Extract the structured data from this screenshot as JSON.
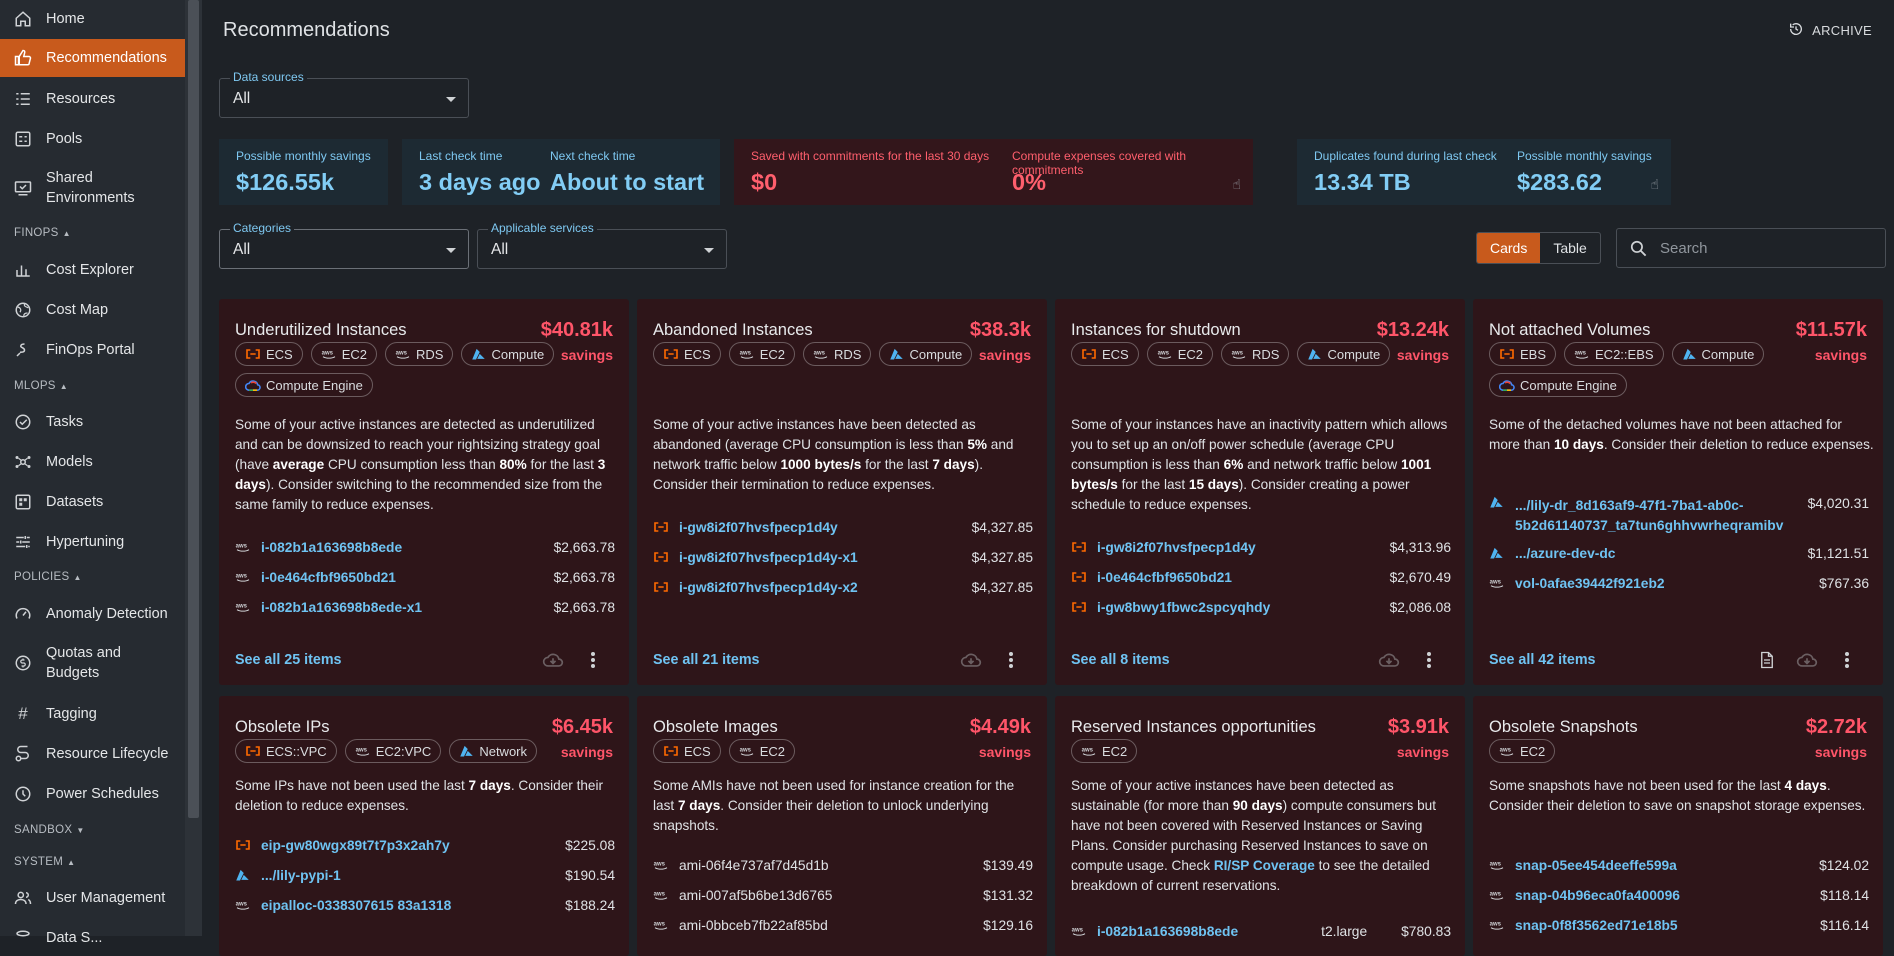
{
  "sidebar": {
    "items": [
      {
        "label": "Home",
        "icon": "home-icon"
      },
      {
        "label": "Recommendations",
        "icon": "thumb-up-icon",
        "active": true
      },
      {
        "label": "Resources",
        "icon": "list-icon"
      },
      {
        "label": "Pools",
        "icon": "pools-icon"
      },
      {
        "label": "Shared Environments",
        "icon": "monitor-icon"
      },
      {
        "label": "Cost Explorer",
        "icon": "bar-chart-icon"
      },
      {
        "label": "Cost Map",
        "icon": "globe-icon"
      },
      {
        "label": "FinOps Portal",
        "icon": "finops-icon"
      },
      {
        "label": "Tasks",
        "icon": "check-circle-icon"
      },
      {
        "label": "Models",
        "icon": "hub-icon"
      },
      {
        "label": "Datasets",
        "icon": "dataset-icon"
      },
      {
        "label": "Hypertuning",
        "icon": "tune-icon"
      },
      {
        "label": "Anomaly Detection",
        "icon": "gauge-icon"
      },
      {
        "label": "Quotas and Budgets",
        "icon": "budget-icon"
      },
      {
        "label": "Tagging",
        "icon": "tag-hash-icon"
      },
      {
        "label": "Resource Lifecycle",
        "icon": "lifecycle-icon"
      },
      {
        "label": "Power Schedules",
        "icon": "clock-icon"
      },
      {
        "label": "User Management",
        "icon": "users-icon"
      },
      {
        "label": "Data S...",
        "icon": "data-icon"
      }
    ],
    "sections": {
      "finops": "FINOPS",
      "mlops": "MLOPS",
      "policies": "POLICIES",
      "sandbox": "SANDBOX",
      "system": "SYSTEM"
    }
  },
  "header": {
    "title": "Recommendations",
    "archive": "ARCHIVE"
  },
  "filters": {
    "data_sources": {
      "label": "Data sources",
      "value": "All"
    },
    "categories": {
      "label": "Categories",
      "value": "All"
    },
    "services": {
      "label": "Applicable services",
      "value": "All"
    }
  },
  "stats": {
    "savings": {
      "label": "Possible monthly savings",
      "value": "$126.55k"
    },
    "last_check": {
      "label": "Last check time",
      "value": "3 days ago"
    },
    "next_check": {
      "label": "Next check time",
      "value": "About to start"
    },
    "commit_saved": {
      "label": "Saved with commitments for the last 30 days",
      "value": "$0"
    },
    "commit_covered": {
      "label": "Compute expenses covered with commitments",
      "value": "0%"
    },
    "duplicates": {
      "label": "Duplicates found during last check",
      "value": "13.34 TB"
    },
    "dup_savings": {
      "label": "Possible monthly savings",
      "value": "$283.62"
    }
  },
  "view": {
    "cards": "Cards",
    "table": "Table",
    "search_placeholder": "Search"
  },
  "savings_word": "savings",
  "cards": [
    {
      "title": "Underutilized Instances",
      "savings": "$40.81k",
      "tags": [
        {
          "t": "ECS",
          "i": "alibaba"
        },
        {
          "t": "EC2",
          "i": "aws"
        },
        {
          "t": "RDS",
          "i": "aws"
        },
        {
          "t": "Compute",
          "i": "azure"
        },
        {
          "t": "Compute Engine",
          "i": "gcp"
        }
      ],
      "items": [
        {
          "n": "i-082b1a163698b8ede",
          "p": "$2,663.78",
          "i": "aws"
        },
        {
          "n": "i-0e464cfbf9650bd21",
          "p": "$2,663.78",
          "i": "aws"
        },
        {
          "n": "i-082b1a163698b8ede-x1",
          "p": "$2,663.78",
          "i": "aws"
        }
      ],
      "see_all": "See all 25 items"
    },
    {
      "title": "Abandoned Instances",
      "savings": "$38.3k",
      "tags": [
        {
          "t": "ECS",
          "i": "alibaba"
        },
        {
          "t": "EC2",
          "i": "aws"
        },
        {
          "t": "RDS",
          "i": "aws"
        },
        {
          "t": "Compute",
          "i": "azure"
        }
      ],
      "items": [
        {
          "n": "i-gw8i2f07hvsfpecp1d4y",
          "p": "$4,327.85",
          "i": "alibaba"
        },
        {
          "n": "i-gw8i2f07hvsfpecp1d4y-x1",
          "p": "$4,327.85",
          "i": "alibaba"
        },
        {
          "n": "i-gw8i2f07hvsfpecp1d4y-x2",
          "p": "$4,327.85",
          "i": "alibaba"
        }
      ],
      "see_all": "See all 21 items"
    },
    {
      "title": "Instances for shutdown",
      "savings": "$13.24k",
      "tags": [
        {
          "t": "ECS",
          "i": "alibaba"
        },
        {
          "t": "EC2",
          "i": "aws"
        },
        {
          "t": "RDS",
          "i": "aws"
        },
        {
          "t": "Compute",
          "i": "azure"
        }
      ],
      "items": [
        {
          "n": "i-gw8i2f07hvsfpecp1d4y",
          "p": "$4,313.96",
          "i": "alibaba"
        },
        {
          "n": "i-0e464cfbf9650bd21",
          "p": "$2,670.49",
          "i": "alibaba"
        },
        {
          "n": "i-gw8bwy1fbwc2spcyqhdy",
          "p": "$2,086.08",
          "i": "alibaba"
        }
      ],
      "see_all": "See all 8 items"
    },
    {
      "title": "Not attached Volumes",
      "savings": "$11.57k",
      "tags": [
        {
          "t": "EBS",
          "i": "alibaba"
        },
        {
          "t": "EC2::EBS",
          "i": "aws"
        },
        {
          "t": "Compute",
          "i": "azure"
        },
        {
          "t": "Compute Engine",
          "i": "gcp"
        }
      ],
      "items": [
        {
          "n": ".../lily-dr_8d163af9-47f1-7ba1-ab0c-5b2d61140737_ta7tun6ghhvwrheqramibv",
          "p": "$4,020.31",
          "i": "azure"
        },
        {
          "n": ".../azure-dev-dc",
          "p": "$1,121.51",
          "i": "azure"
        },
        {
          "n": "vol-0afae39442f921eb2",
          "p": "$767.36",
          "i": "aws"
        }
      ],
      "see_all": "See all 42 items"
    },
    {
      "title": "Obsolete IPs",
      "savings": "$6.45k",
      "tags": [
        {
          "t": "ECS::VPC",
          "i": "alibaba"
        },
        {
          "t": "EC2:VPC",
          "i": "aws"
        },
        {
          "t": "Network",
          "i": "azure"
        }
      ],
      "items": [
        {
          "n": "eip-gw80wgx89t7t7p3x2ah7y",
          "p": "$225.08",
          "i": "alibaba"
        },
        {
          "n": ".../lily-pypi-1",
          "p": "$190.54",
          "i": "azure"
        },
        {
          "n": "eipalloc-0338307615 83a1318",
          "p": "$188.24",
          "i": "aws"
        }
      ],
      "see_all": ""
    },
    {
      "title": "Obsolete Images",
      "savings": "$4.49k",
      "tags": [
        {
          "t": "ECS",
          "i": "alibaba"
        },
        {
          "t": "EC2",
          "i": "aws"
        }
      ],
      "items": [
        {
          "n": "ami-06f4e737af7d45d1b",
          "p": "$139.49",
          "i": "aws"
        },
        {
          "n": "ami-007af5b6be13d6765",
          "p": "$131.32",
          "i": "aws"
        },
        {
          "n": "ami-0bbceb7fb22af85bd",
          "p": "$129.16",
          "i": "aws"
        }
      ],
      "see_all": ""
    },
    {
      "title": "Reserved Instances opportunities",
      "savings": "$3.91k",
      "tags": [
        {
          "t": "EC2",
          "i": "aws"
        }
      ],
      "items": [
        {
          "n": "i-082b1a163698b8ede",
          "m": "t2.large",
          "p": "$780.83",
          "i": "aws"
        }
      ],
      "see_all": ""
    },
    {
      "title": "Obsolete Snapshots",
      "savings": "$2.72k",
      "tags": [
        {
          "t": "EC2",
          "i": "aws"
        }
      ],
      "items": [
        {
          "n": "snap-05ee454deeffe599a",
          "p": "$124.02",
          "i": "aws"
        },
        {
          "n": "snap-04b96eca0fa400096",
          "p": "$118.14",
          "i": "aws"
        },
        {
          "n": "snap-0f8f3562ed71e18b5",
          "p": "$116.14",
          "i": "aws"
        }
      ],
      "see_all": ""
    }
  ],
  "desc": {
    "c0": [
      "Some of your active instances are detected as underutilized and can be downsized to reach your rightsizing strategy goal (have ",
      "average",
      " CPU consumption less than ",
      "80%",
      " for the last ",
      "3 days",
      "). Consider switching to the recommended size from the same family to reduce expenses."
    ],
    "c1": [
      "Some of your active instances have been detected as abandoned (average CPU consumption is less than ",
      "5%",
      " and network traffic below ",
      "1000 bytes/s",
      " for the last ",
      "7 days",
      "). Consider their termination to reduce expenses."
    ],
    "c2": [
      "Some of your instances have an inactivity pattern which allows you to set up an on/off power schedule (average CPU consumption is less than ",
      "6%",
      " and network traffic below ",
      "1001 bytes/s",
      " for the last ",
      "15 days",
      "). Consider creating a power schedule to reduce expenses."
    ],
    "c3": [
      "Some of the detached volumes have not been attached for more than ",
      "10 days",
      ". Consider their deletion to reduce expenses."
    ],
    "c4": [
      "Some IPs have not been used the last ",
      "7 days",
      ". Consider their deletion to reduce expenses."
    ],
    "c5": [
      "Some AMIs have not been used for instance creation for the last ",
      "7 days",
      ". Consider their deletion to unlock underlying snapshots."
    ],
    "c6": [
      "Some of your active instances have been detected as sustainable (for more than ",
      "90 days",
      ") compute consumers but have not been covered with Reserved Instances or Saving Plans. Consider purchasing Reserved Instances to save on compute usage. Check ",
      "RI/SP Coverage",
      " to see the detailed breakdown of current reservations."
    ],
    "c7": [
      "Some snapshots have not been used for the last ",
      "4 days",
      ". Consider their deletion to save on snapshot storage expenses."
    ]
  },
  "colors": {
    "accent": "#c85a1c",
    "link": "#6fc3f2",
    "danger": "#ff5569",
    "card_bg": "#2e1519"
  }
}
